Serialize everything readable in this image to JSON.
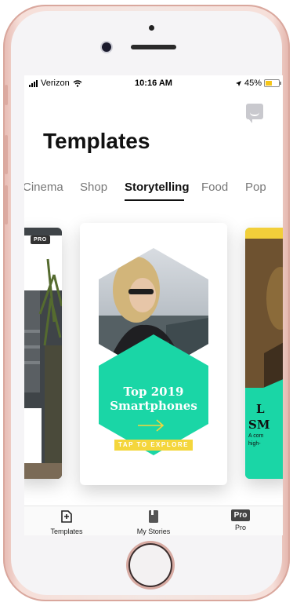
{
  "status_bar": {
    "carrier": "Verizon",
    "time": "10:16 AM",
    "battery": "45%"
  },
  "header": {
    "title": "Templates"
  },
  "tabs": [
    "Cinema",
    "Shop",
    "Storytelling",
    "Food",
    "Pop"
  ],
  "active_tab": "Storytelling",
  "cards": {
    "left": {
      "badge": "PRO"
    },
    "center": {
      "title_line1": "Top 2019",
      "title_line2": "Smartphones",
      "cta": "TAP TO EXPLORE"
    },
    "right": {
      "line1": "L",
      "line2": "SM",
      "line3": "A com",
      "line4": "high-"
    }
  },
  "bottom_nav": [
    {
      "label": "Templates",
      "icon": "template-add-icon"
    },
    {
      "label": "My Stories",
      "icon": "book-icon"
    },
    {
      "label": "Pro",
      "icon": "pro-badge-icon",
      "badge": "Pro"
    }
  ],
  "colors": {
    "accent_teal": "#1ad6a6",
    "accent_yellow": "#f4d63c",
    "phone_frame": "#f3d6cf"
  }
}
